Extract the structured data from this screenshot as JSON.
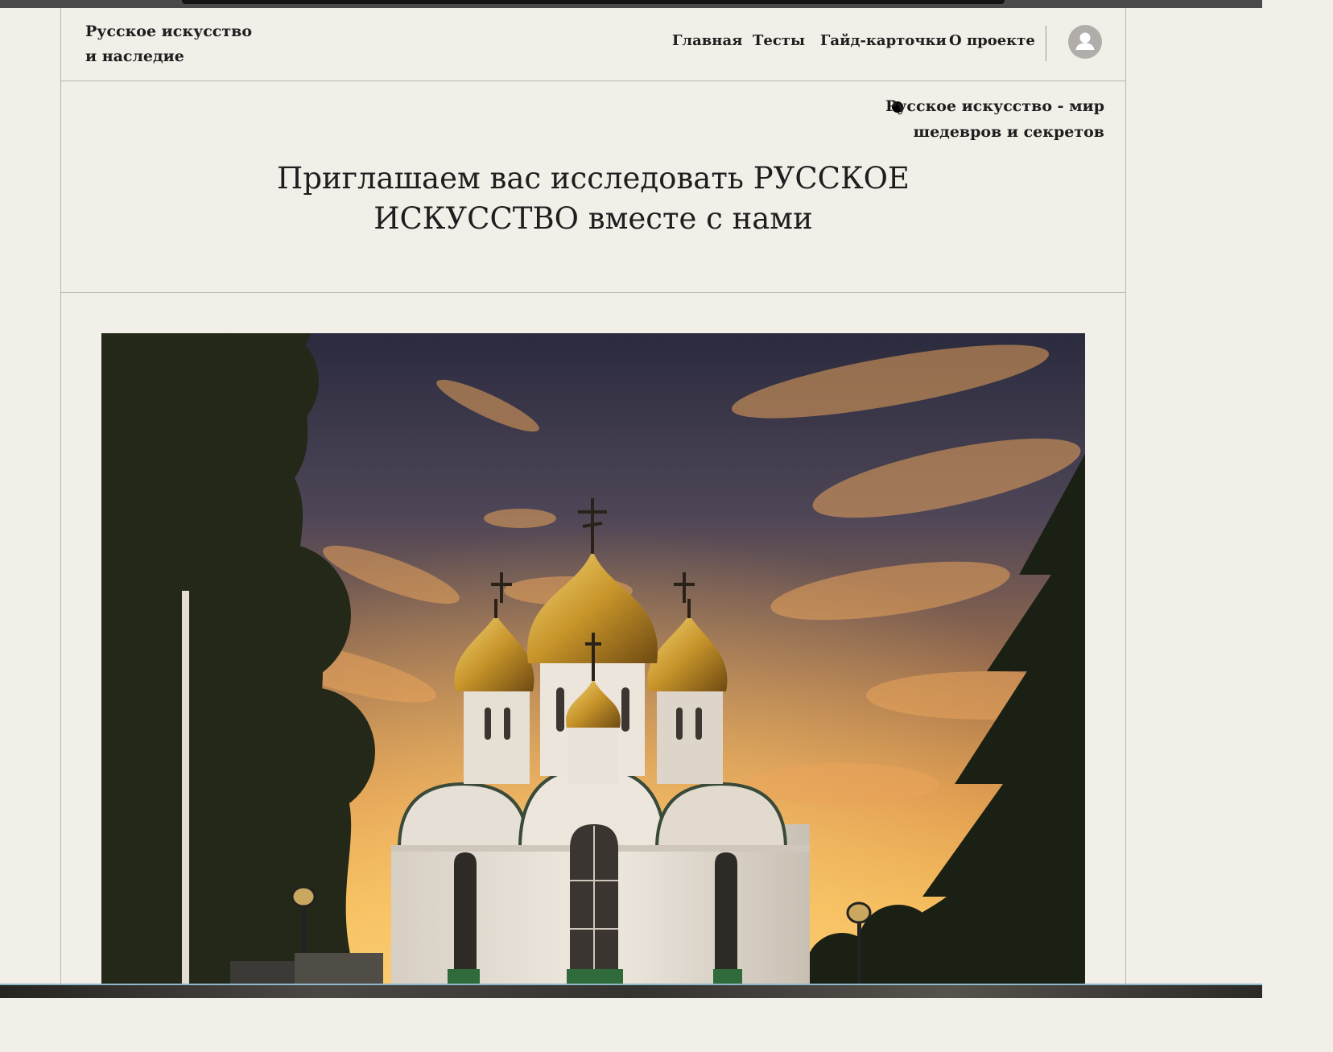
{
  "site": {
    "brand_line1": "Русское искусство",
    "brand_line2": "и наследие"
  },
  "nav": {
    "items": [
      {
        "label": "Главная"
      },
      {
        "label": "Тесты"
      },
      {
        "label": "Гайд-карточки"
      },
      {
        "label": "О проекте"
      }
    ],
    "avatar_icon": "user-icon"
  },
  "hero": {
    "bullet_icon": "bullet-dot",
    "tagline": "Русское искусство - мир шедевров и секретов",
    "headline": "Приглашаем вас исследовать РУССКОЕ ИСКУССТВО вместе с нами"
  },
  "image": {
    "subject": "cathedral-with-golden-domes-at-sunset"
  },
  "colors": {
    "page_background": "#f2eee8",
    "text": "#1e1e1e",
    "divider": "#b9b6b1",
    "avatar": "#b0adaa",
    "dome_gold": "#c8952a"
  }
}
